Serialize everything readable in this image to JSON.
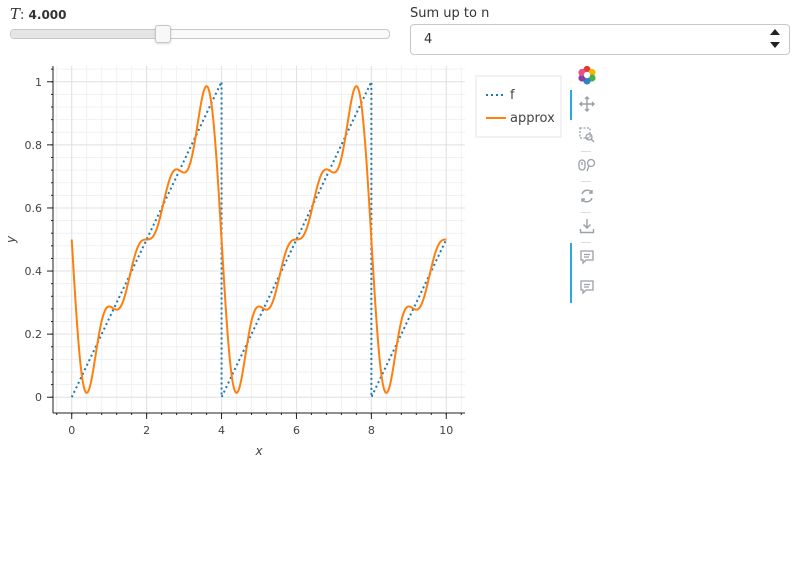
{
  "controls": {
    "period": {
      "symbol": "T",
      "separator": ":",
      "value": "4.000",
      "fraction": 0.4
    },
    "terms": {
      "label": "Sum up to n",
      "value": "4"
    }
  },
  "chart_data": {
    "type": "line",
    "xlabel": "x",
    "ylabel": "y",
    "xlim": [
      -0.5,
      10.5
    ],
    "ylim": [
      -0.05,
      1.05
    ],
    "xticks": [
      "0",
      "2",
      "4",
      "6",
      "8",
      "10"
    ],
    "yticks": [
      "0",
      "0.2",
      "0.4",
      "0.6",
      "0.8",
      "1"
    ],
    "grid": true,
    "legend_position": "right, outside plot",
    "period": 4,
    "n_terms": 4,
    "series": [
      {
        "name": "f",
        "style": "dotted",
        "color": "#1f77b4",
        "points": [
          [
            0,
            0
          ],
          [
            4,
            1
          ],
          [
            4,
            0
          ],
          [
            8,
            1
          ],
          [
            8,
            0
          ],
          [
            10,
            0.5
          ]
        ]
      },
      {
        "name": "approx",
        "style": "solid",
        "color": "#ff7f0e",
        "points": [
          [
            0,
            0.5
          ],
          [
            0.4,
            0.01
          ],
          [
            0.9,
            0.28
          ],
          [
            1.2,
            0.28
          ],
          [
            1.5,
            0.45
          ],
          [
            1.8,
            0.5
          ],
          [
            2,
            0.5
          ],
          [
            2.2,
            0.55
          ],
          [
            2.5,
            0.7
          ],
          [
            2.8,
            0.72
          ],
          [
            3.1,
            0.75
          ],
          [
            3.6,
            0.98
          ],
          [
            4,
            0.5
          ],
          [
            4.4,
            0.01
          ],
          [
            4.9,
            0.28
          ],
          [
            5.2,
            0.28
          ],
          [
            5.5,
            0.45
          ],
          [
            5.8,
            0.5
          ],
          [
            6,
            0.5
          ],
          [
            6.2,
            0.55
          ],
          [
            6.5,
            0.7
          ],
          [
            6.8,
            0.72
          ],
          [
            7.1,
            0.75
          ],
          [
            7.6,
            0.98
          ],
          [
            8,
            0.5
          ],
          [
            8.4,
            0.01
          ],
          [
            8.9,
            0.28
          ],
          [
            9.2,
            0.28
          ],
          [
            9.5,
            0.45
          ],
          [
            9.8,
            0.5
          ],
          [
            10,
            0.5
          ]
        ]
      }
    ]
  },
  "toolbar": {
    "logo_icon": "bokeh-logo-icon",
    "tools": [
      "pan-icon",
      "box-zoom-icon",
      "wheel-zoom-icon",
      "reset-icon",
      "save-icon",
      "hover-icon",
      "hover-icon"
    ]
  }
}
